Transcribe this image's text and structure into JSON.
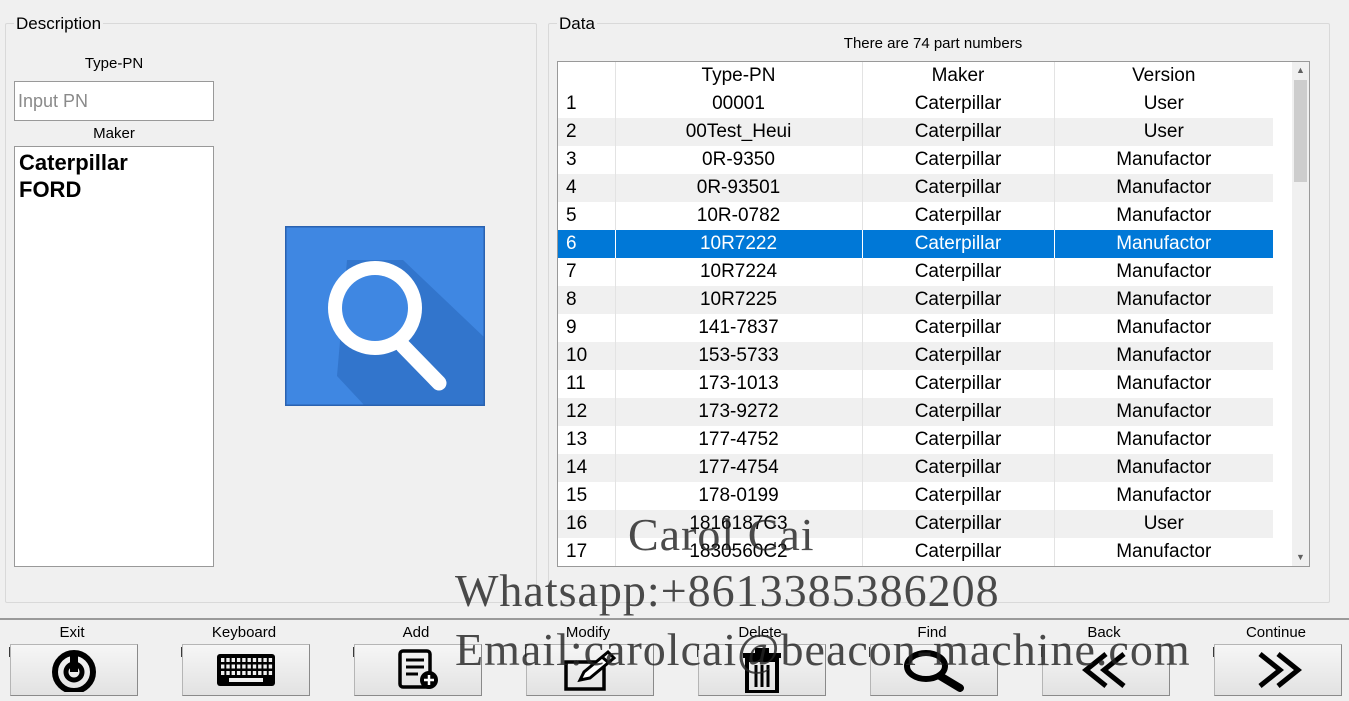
{
  "description": {
    "group_title": "Description",
    "typepn_label": "Type-PN",
    "typepn_placeholder": "Input PN",
    "typepn_value": "",
    "maker_label": "Maker",
    "makers": [
      "Caterpillar",
      "FORD"
    ],
    "search_icon": "magnifier-icon"
  },
  "data": {
    "group_title": "Data",
    "count_text": "There are 74 part numbers",
    "columns": [
      "",
      "Type-PN",
      "Maker",
      "Version"
    ],
    "selected_row": 6,
    "rows": [
      [
        "1",
        "00001",
        "Caterpillar",
        "User"
      ],
      [
        "2",
        "00Test_Heui",
        "Caterpillar",
        "User"
      ],
      [
        "3",
        "0R-9350",
        "Caterpillar",
        "Manufactor"
      ],
      [
        "4",
        "0R-93501",
        "Caterpillar",
        "Manufactor"
      ],
      [
        "5",
        "10R-0782",
        "Caterpillar",
        "Manufactor"
      ],
      [
        "6",
        "10R7222",
        "Caterpillar",
        "Manufactor"
      ],
      [
        "7",
        "10R7224",
        "Caterpillar",
        "Manufactor"
      ],
      [
        "8",
        "10R7225",
        "Caterpillar",
        "Manufactor"
      ],
      [
        "9",
        "141-7837",
        "Caterpillar",
        "Manufactor"
      ],
      [
        "10",
        "153-5733",
        "Caterpillar",
        "Manufactor"
      ],
      [
        "11",
        "173-1013",
        "Caterpillar",
        "Manufactor"
      ],
      [
        "12",
        "173-9272",
        "Caterpillar",
        "Manufactor"
      ],
      [
        "13",
        "177-4752",
        "Caterpillar",
        "Manufactor"
      ],
      [
        "14",
        "177-4754",
        "Caterpillar",
        "Manufactor"
      ],
      [
        "15",
        "178-0199",
        "Caterpillar",
        "Manufactor"
      ],
      [
        "16",
        "1816187C3",
        "Caterpillar",
        "User"
      ],
      [
        "17",
        "1830560C2",
        "Caterpillar",
        "Manufactor"
      ]
    ]
  },
  "toolbar": [
    {
      "label": "Exit",
      "key": "F1",
      "icon": "power-icon"
    },
    {
      "label": "Keyboard",
      "key": "F2",
      "icon": "keyboard-icon"
    },
    {
      "label": "Add",
      "key": "F3",
      "icon": "add-list-icon"
    },
    {
      "label": "Modify",
      "key": "F4",
      "icon": "edit-icon"
    },
    {
      "label": "Delete",
      "key": "F5",
      "icon": "trash-icon"
    },
    {
      "label": "Find",
      "key": "F6",
      "icon": "search-icon"
    },
    {
      "label": "Back",
      "key": "F7",
      "icon": "double-chevron-left-icon"
    },
    {
      "label": "Continue",
      "key": "F8",
      "icon": "double-chevron-right-icon"
    }
  ],
  "watermark": {
    "name": "Carol Cai",
    "whatsapp": "Whatsapp:+8613385386208",
    "email": "Email:carolcai@beacon-machine.com"
  },
  "colors": {
    "selection": "#0078d7",
    "search_tile": "#3f87e2",
    "background": "#f0f0f0"
  }
}
